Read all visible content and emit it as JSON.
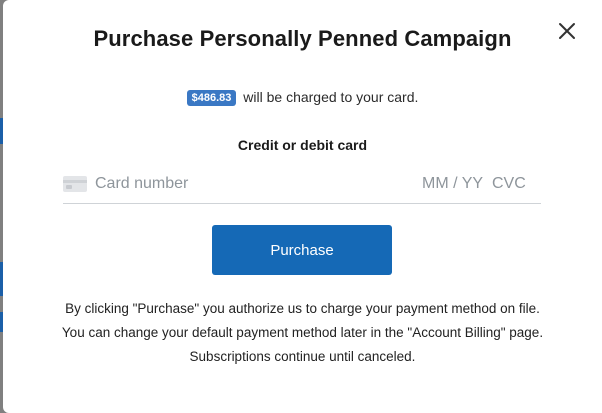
{
  "modal": {
    "title": "Purchase Personally Penned Campaign",
    "close_icon": "close-icon"
  },
  "charge": {
    "amount": "$486.83",
    "text": "will be charged to your card."
  },
  "card": {
    "section_label": "Credit or debit card",
    "icon": "credit-card-icon",
    "number_placeholder": "Card number",
    "expiry_placeholder": "MM / YY",
    "cvc_placeholder": "CVC"
  },
  "actions": {
    "purchase_label": "Purchase"
  },
  "disclaimer": {
    "text": "By clicking \"Purchase\" you authorize us to charge your payment method on file. You can change your default payment method later in the \"Account Billing\" page. Subscriptions continue until canceled."
  },
  "colors": {
    "accent": "#1569b6",
    "badge": "#3a78c4"
  }
}
